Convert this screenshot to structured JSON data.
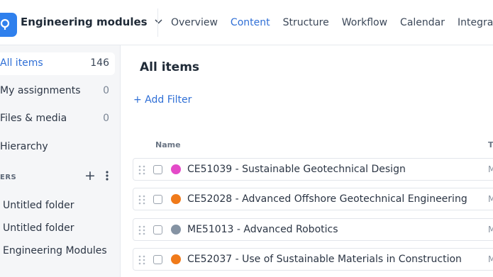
{
  "header": {
    "project_name": "Engineering modules",
    "nav": [
      "Overview",
      "Content",
      "Structure",
      "Workflow",
      "Calendar",
      "Integrations"
    ],
    "active_nav": "Content"
  },
  "sidebar": {
    "items": [
      {
        "label": "All items",
        "count": "146",
        "active": true
      },
      {
        "label": "My assignments",
        "count": "0"
      },
      {
        "label": "Files & media",
        "count": "0"
      },
      {
        "label": "Hierarchy",
        "count": ""
      }
    ],
    "section_label": "ERS",
    "folders": [
      "Untitled folder",
      "Untitled folder",
      "Engineering Modules"
    ]
  },
  "main": {
    "title": "All items",
    "add_filter": "+ Add Filter",
    "columns": {
      "name": "Name",
      "type_partial": "T"
    },
    "rows": [
      {
        "title": "CE51039 - Sustainable Geotechnical Design",
        "dot_color": "#e44ac8",
        "trail": "M"
      },
      {
        "title": "CE52028 - Advanced Offshore Geotechnical Engineering",
        "dot_color": "#f07a1a",
        "trail": "M"
      },
      {
        "title": "ME51013 - Advanced Robotics",
        "dot_color": "#8593a3",
        "trail": "M"
      },
      {
        "title": "CE52037 - Use of Sustainable Materials in Construction",
        "dot_color": "#f07a1a",
        "trail": "M"
      }
    ]
  }
}
